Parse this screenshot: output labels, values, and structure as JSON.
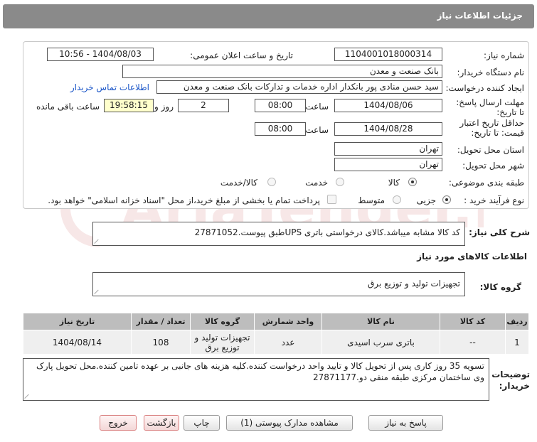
{
  "header": {
    "title": "جزئیات اطلاعات نیاز"
  },
  "form": {
    "need_number_label": "شماره نیاز:",
    "need_number": "1104001018000314",
    "announce_label": "تاریخ و ساعت اعلان عمومی:",
    "announce_value": "1404/08/03 - 10:56",
    "buyer_org_label": "نام دستگاه خریدار:",
    "buyer_org": "بانک صنعت و معدن",
    "requester_label": "ایجاد کننده درخواست:",
    "requester": "سید حسن منادی پور بانکدار اداره خدمات و تدارکات بانک صنعت و معدن",
    "contact_link": "اطلاعات تماس خریدار",
    "reply_deadline_label": "مهلت ارسال پاسخ: تا تاریخ:",
    "reply_date": "1404/08/06",
    "time_label": "ساعت",
    "reply_time": "08:00",
    "days_value": "2",
    "days_label": "روز و",
    "remaining_time": "19:58:15",
    "remaining_label": "ساعت باقی مانده",
    "min_validity_label": "حداقل تاریخ اعتبار قیمت: تا تاریخ:",
    "validity_date": "1404/08/28",
    "validity_time": "08:00",
    "province_label": "استان محل تحویل:",
    "province": "تهران",
    "city_label": "شهر محل تحویل:",
    "city": "تهران",
    "category_label": "طبقه بندی موضوعی:",
    "category_options": [
      "کالا",
      "خدمت",
      "کالا/خدمت"
    ],
    "process_label": "نوع فرآیند خرید :",
    "process_options": [
      "جزیی",
      "متوسط"
    ],
    "payment_note": "پرداخت تمام یا بخشی از مبلغ خرید،از محل \"اسناد خزانه اسلامی\" خواهد بود."
  },
  "description": {
    "label": "شرح کلی نیاز:",
    "value": "کد کالا مشابه میباشد.کالای درخواستی باتری UPSطبق پیوست.27871052"
  },
  "goods_info_title": "اطلاعات کالاهای مورد نیاز",
  "goods_group": {
    "label": "گروه کالا:",
    "value": "تجهیزات تولید و توزیع برق"
  },
  "table": {
    "headers": [
      "ردیف",
      "کد کالا",
      "نام کالا",
      "واحد شمارش",
      "گروه کالا",
      "تعداد / مقدار",
      "تاریخ نیاز"
    ],
    "rows": [
      {
        "row": "1",
        "code": "--",
        "name": "باتری سرب اسیدی",
        "unit": "عدد",
        "group": "تجهیزات تولید و توزیع برق",
        "qty": "108",
        "date": "1404/08/14"
      }
    ]
  },
  "buyer_notes": {
    "label": "توضیحات خریدار:",
    "value": "تسویه 35 روز کاری پس از تحویل کالا و تایید واحد درخواست کننده.کلیه هزینه های جانبی بر عهده تامین کننده.محل تحویل پارک وی ساختمان مرکزی طبقه منفی دو.27871177"
  },
  "buttons": {
    "reply": "پاسخ به نیاز",
    "attachments": "مشاهده مدارک پیوستی (1)",
    "print": "چاپ",
    "back": "بازگشت",
    "exit": "خروج"
  },
  "watermark": {
    "text": "AriaTender.neT"
  },
  "colors": {
    "header": "#8a8a8a",
    "link": "#1b56c8",
    "time_badge": "#ffffcc",
    "table_header": "#bdbdbd",
    "table_row": "#efefef"
  }
}
